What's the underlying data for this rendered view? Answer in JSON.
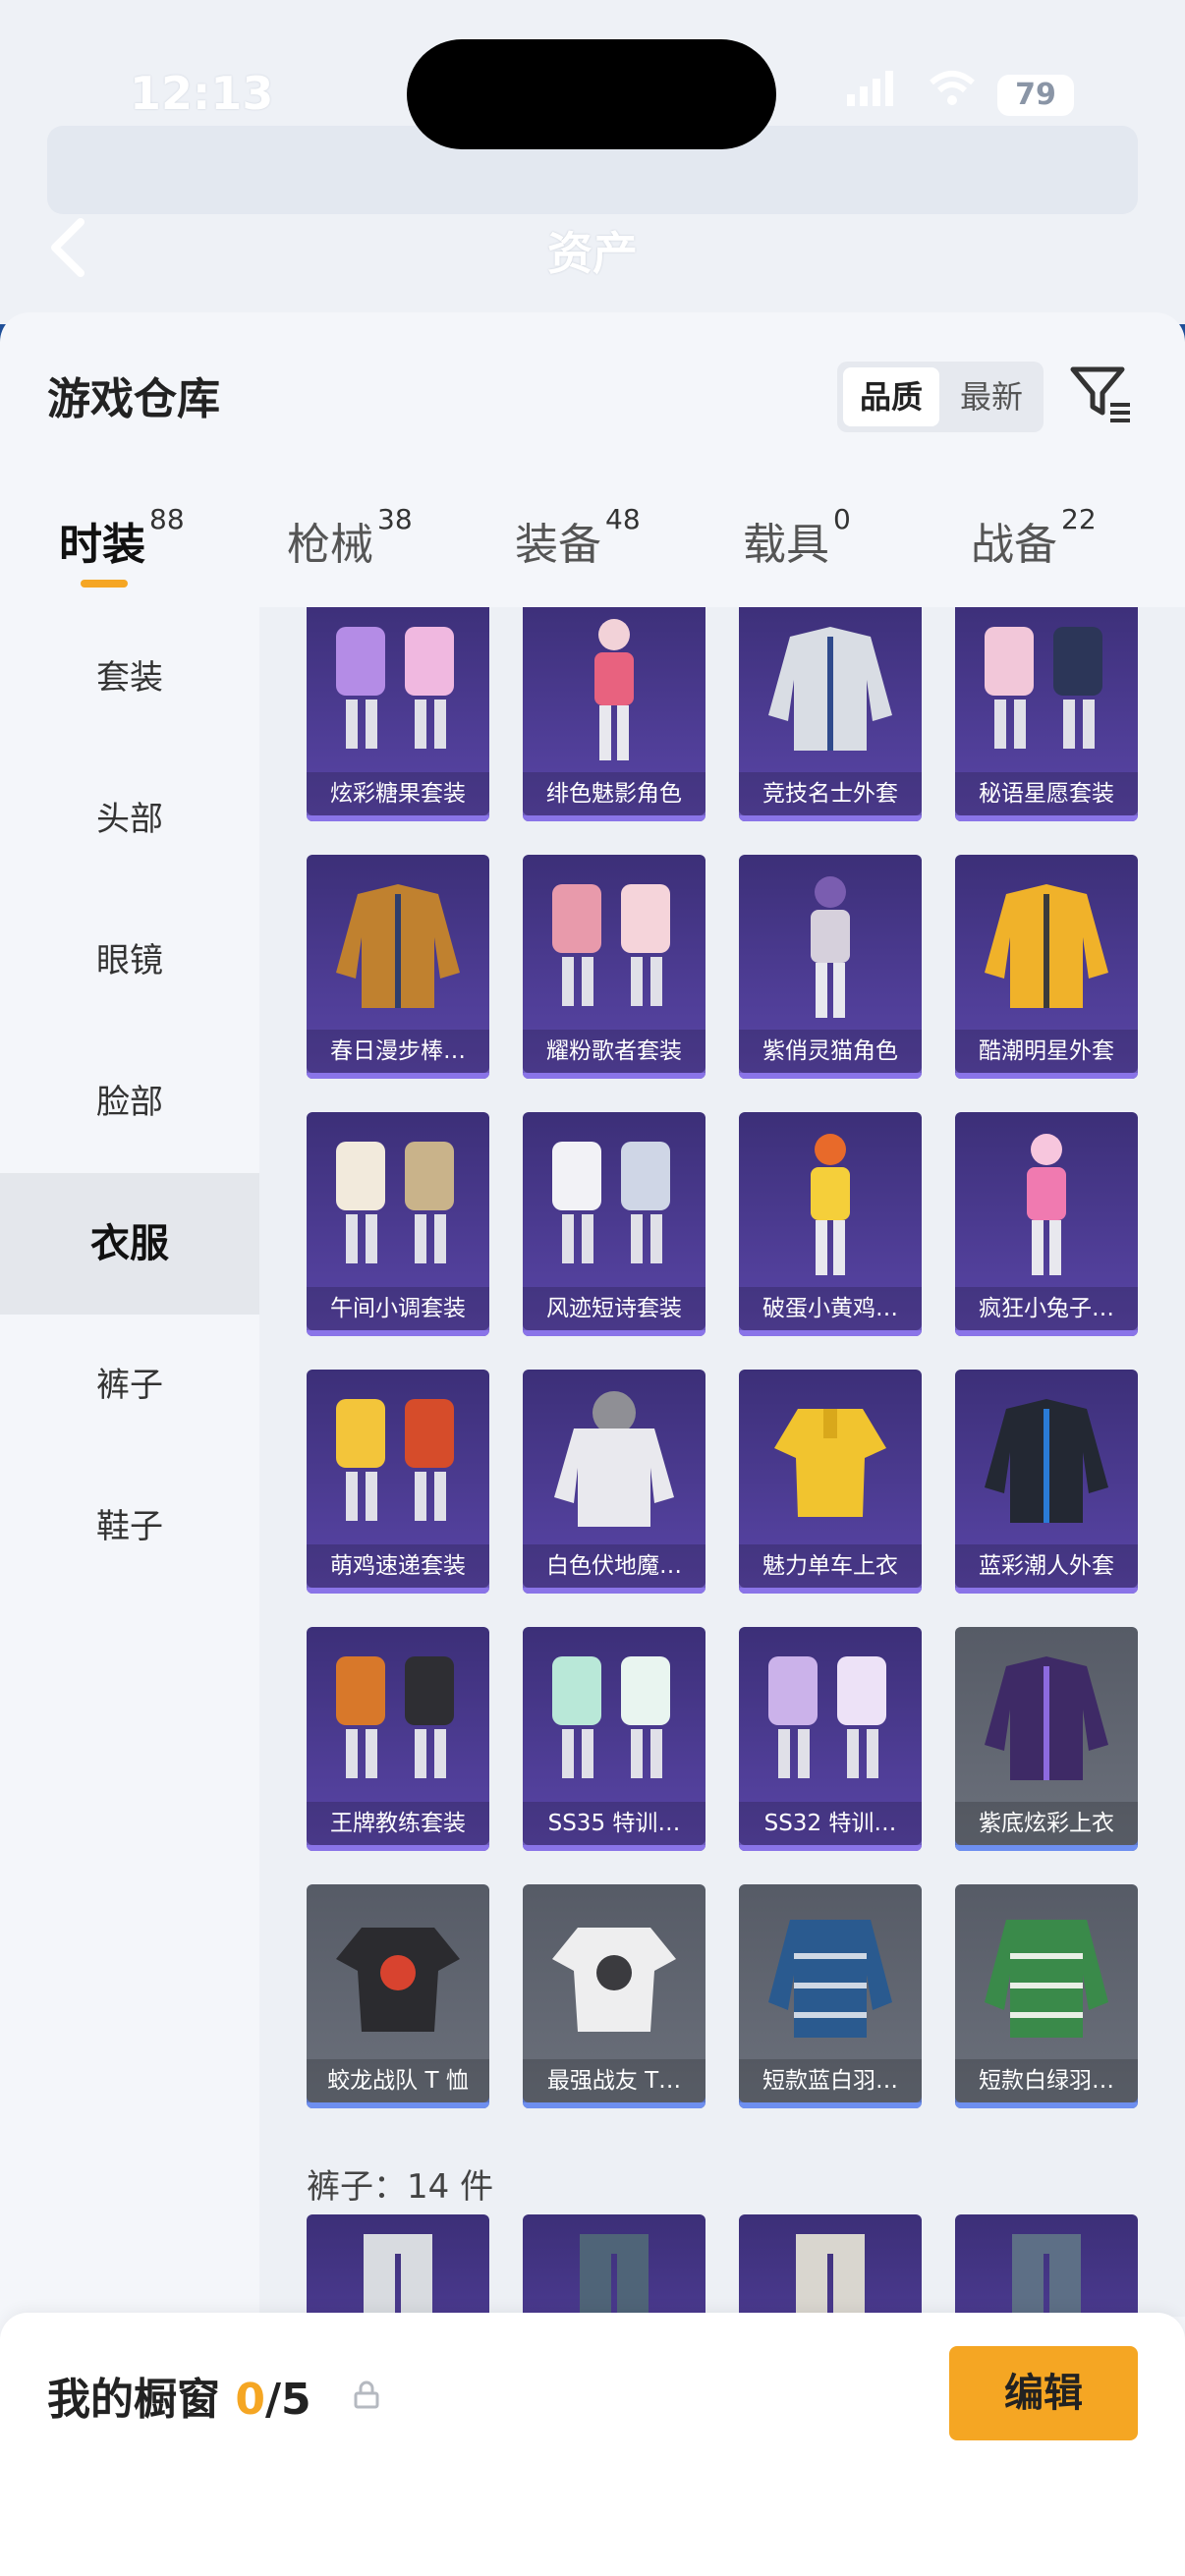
{
  "status": {
    "time": "12:13",
    "battery": "79"
  },
  "header": {
    "title": "资产"
  },
  "sheet": {
    "title": "游戏仓库",
    "sort": {
      "quality": "品质",
      "newest": "最新",
      "active": "quality"
    }
  },
  "tabs": [
    {
      "label": "时装",
      "count": "88",
      "active": true
    },
    {
      "label": "枪械",
      "count": "38",
      "active": false
    },
    {
      "label": "装备",
      "count": "48",
      "active": false
    },
    {
      "label": "载具",
      "count": "0",
      "active": false
    },
    {
      "label": "战备",
      "count": "22",
      "active": false
    }
  ],
  "sidebar": {
    "items": [
      {
        "label": "套装",
        "active": false
      },
      {
        "label": "头部",
        "active": false
      },
      {
        "label": "眼镜",
        "active": false
      },
      {
        "label": "脸部",
        "active": false
      },
      {
        "label": "衣服",
        "active": true
      },
      {
        "label": "裤子",
        "active": false
      },
      {
        "label": "鞋子",
        "active": false
      }
    ]
  },
  "items": [
    {
      "name": "炫彩糖果套装",
      "rarity": "purple",
      "icon": "outfit-set"
    },
    {
      "name": "绯色魅影角色",
      "rarity": "purple",
      "icon": "character"
    },
    {
      "name": "竞技名士外套",
      "rarity": "purple",
      "icon": "jacket"
    },
    {
      "name": "秘语星愿套装",
      "rarity": "purple",
      "icon": "outfit-set"
    },
    {
      "name": "春日漫步棒…",
      "rarity": "purple",
      "icon": "jacket"
    },
    {
      "name": "耀粉歌者套装",
      "rarity": "purple",
      "icon": "outfit-set"
    },
    {
      "name": "紫俏灵猫角色",
      "rarity": "purple",
      "icon": "character"
    },
    {
      "name": "酷潮明星外套",
      "rarity": "purple",
      "icon": "jacket"
    },
    {
      "name": "午间小调套装",
      "rarity": "purple",
      "icon": "outfit-set"
    },
    {
      "name": "风迹短诗套装",
      "rarity": "purple",
      "icon": "outfit-set"
    },
    {
      "name": "破蛋小黄鸡…",
      "rarity": "purple",
      "icon": "character"
    },
    {
      "name": "疯狂小兔子…",
      "rarity": "purple",
      "icon": "character"
    },
    {
      "name": "萌鸡速递套装",
      "rarity": "purple",
      "icon": "outfit-set"
    },
    {
      "name": "白色伏地魔…",
      "rarity": "purple",
      "icon": "hoodie"
    },
    {
      "name": "魅力单车上衣",
      "rarity": "purple",
      "icon": "shirt"
    },
    {
      "name": "蓝彩潮人外套",
      "rarity": "purple",
      "icon": "jacket"
    },
    {
      "name": "王牌教练套装",
      "rarity": "purple",
      "icon": "outfit-set"
    },
    {
      "name": "SS35 特训…",
      "rarity": "purple",
      "icon": "outfit-set"
    },
    {
      "name": "SS32 特训…",
      "rarity": "purple",
      "icon": "outfit-set"
    },
    {
      "name": "紫底炫彩上衣",
      "rarity": "blue",
      "icon": "jacket"
    },
    {
      "name": "蛟龙战队 T 恤",
      "rarity": "blue",
      "icon": "tshirt"
    },
    {
      "name": "最强战友 T…",
      "rarity": "blue",
      "icon": "tshirt"
    },
    {
      "name": "短款蓝白羽…",
      "rarity": "blue",
      "icon": "down-jacket"
    },
    {
      "name": "短款白绿羽…",
      "rarity": "blue",
      "icon": "down-jacket"
    }
  ],
  "section": {
    "label": "裤子：14 件"
  },
  "pants_preview": [
    {
      "icon": "pants"
    },
    {
      "icon": "pants"
    },
    {
      "icon": "pants"
    },
    {
      "icon": "pants"
    }
  ],
  "showcase": {
    "label": "我的橱窗 ",
    "count": "0",
    "total": "/5",
    "edit": "编辑"
  },
  "colors": {
    "accent": "#f5a623",
    "purple_card": "#4a3a95",
    "blue_card": "#5e636e"
  }
}
